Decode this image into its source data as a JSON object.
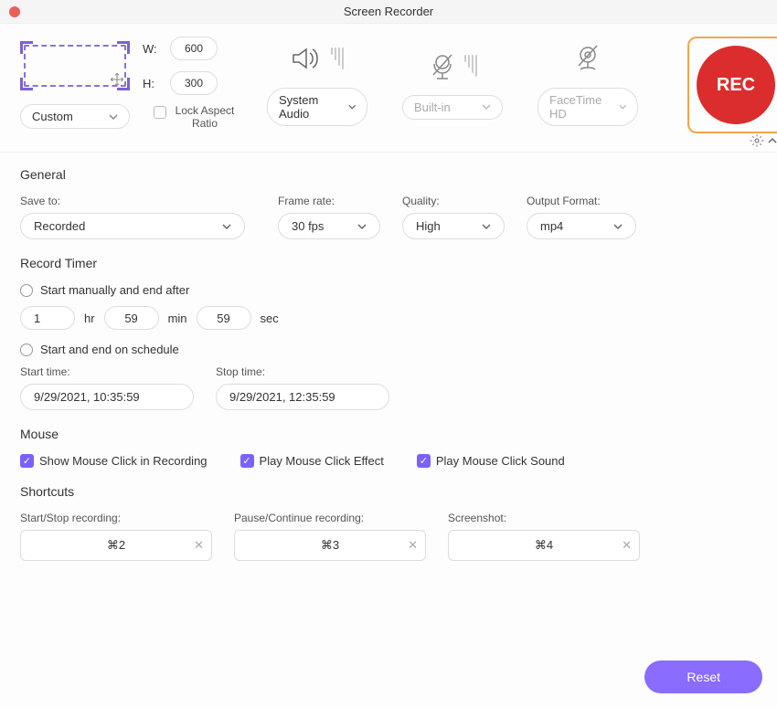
{
  "title": "Screen Recorder",
  "area": {
    "width_label": "W:",
    "height_label": "H:",
    "width": "600",
    "height": "300",
    "mode": "Custom",
    "lock_label": "Lock Aspect Ratio"
  },
  "audio": {
    "system_select": "System Audio",
    "mic_select": "Built-in",
    "camera_select": "FaceTime HD"
  },
  "rec_label": "REC",
  "general": {
    "title": "General",
    "save_to_label": "Save to:",
    "save_to": "Recorded",
    "frame_rate_label": "Frame rate:",
    "frame_rate": "30 fps",
    "quality_label": "Quality:",
    "quality": "High",
    "format_label": "Output Format:",
    "format": "mp4"
  },
  "timer": {
    "title": "Record Timer",
    "manual_label": "Start manually and end after",
    "hr": "1",
    "hr_label": "hr",
    "min": "59",
    "min_label": "min",
    "sec": "59",
    "sec_label": "sec",
    "schedule_label": "Start and end on schedule",
    "start_label": "Start time:",
    "start_value": "9/29/2021, 10:35:59",
    "stop_label": "Stop time:",
    "stop_value": "9/29/2021, 12:35:59"
  },
  "mouse": {
    "title": "Mouse",
    "show_click": "Show Mouse Click in Recording",
    "play_effect": "Play Mouse Click Effect",
    "play_sound": "Play Mouse Click Sound"
  },
  "shortcuts": {
    "title": "Shortcuts",
    "start_label": "Start/Stop recording:",
    "start_value": "⌘2",
    "pause_label": "Pause/Continue recording:",
    "pause_value": "⌘3",
    "shot_label": "Screenshot:",
    "shot_value": "⌘4"
  },
  "reset_label": "Reset"
}
